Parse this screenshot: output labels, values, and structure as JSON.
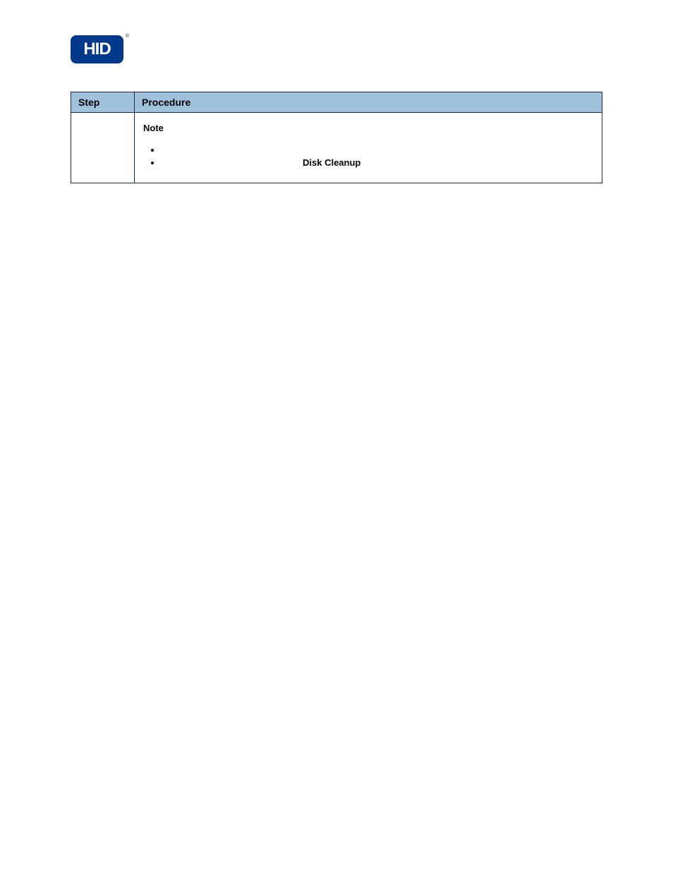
{
  "logo": {
    "text": "HID",
    "regmark": "®"
  },
  "table": {
    "headers": {
      "step": "Step",
      "procedure": "Procedure"
    },
    "row": {
      "note_label": "Note",
      "bold_text": "Disk Cleanup"
    }
  }
}
